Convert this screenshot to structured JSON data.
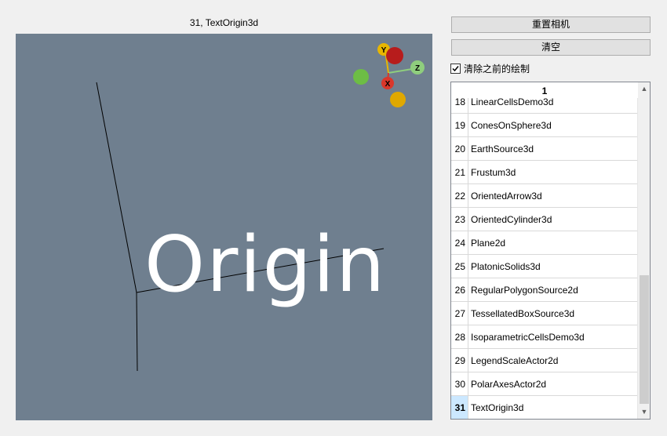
{
  "viewport": {
    "title": "31, TextOrigin3d",
    "text_actor": "Origin",
    "background_color": "#6f7f8f",
    "orientation_widget": {
      "labels": {
        "y": "Y",
        "z": "Z",
        "x": "X"
      },
      "colors": {
        "y": "#e8b600",
        "z": "#8fce7d",
        "x": "#d9372b",
        "top_sphere": "#b71c1c",
        "left_sphere": "#6dbd45",
        "bottom_sphere": "#e0a800"
      }
    }
  },
  "controls": {
    "reset_camera_label": "重置相机",
    "clear_label": "清空",
    "clear_previous_label": "清除之前的绘制",
    "clear_previous_checked": true
  },
  "list": {
    "header": "1",
    "items": [
      {
        "num": "18",
        "name": "LinearCellsDemo3d"
      },
      {
        "num": "19",
        "name": "ConesOnSphere3d"
      },
      {
        "num": "20",
        "name": "EarthSource3d"
      },
      {
        "num": "21",
        "name": "Frustum3d"
      },
      {
        "num": "22",
        "name": "OrientedArrow3d"
      },
      {
        "num": "23",
        "name": "OrientedCylinder3d"
      },
      {
        "num": "24",
        "name": "Plane2d"
      },
      {
        "num": "25",
        "name": "PlatonicSolids3d"
      },
      {
        "num": "26",
        "name": "RegularPolygonSource2d"
      },
      {
        "num": "27",
        "name": "TessellatedBoxSource3d"
      },
      {
        "num": "28",
        "name": "IsoparametricCellsDemo3d"
      },
      {
        "num": "29",
        "name": "LegendScaleActor2d"
      },
      {
        "num": "30",
        "name": "PolarAxesActor2d"
      },
      {
        "num": "31",
        "name": "TextOrigin3d"
      }
    ],
    "selected": "31",
    "scroll_up_icon": "▲",
    "scroll_down_icon": "▼",
    "accent_color": "#cce8ff"
  }
}
